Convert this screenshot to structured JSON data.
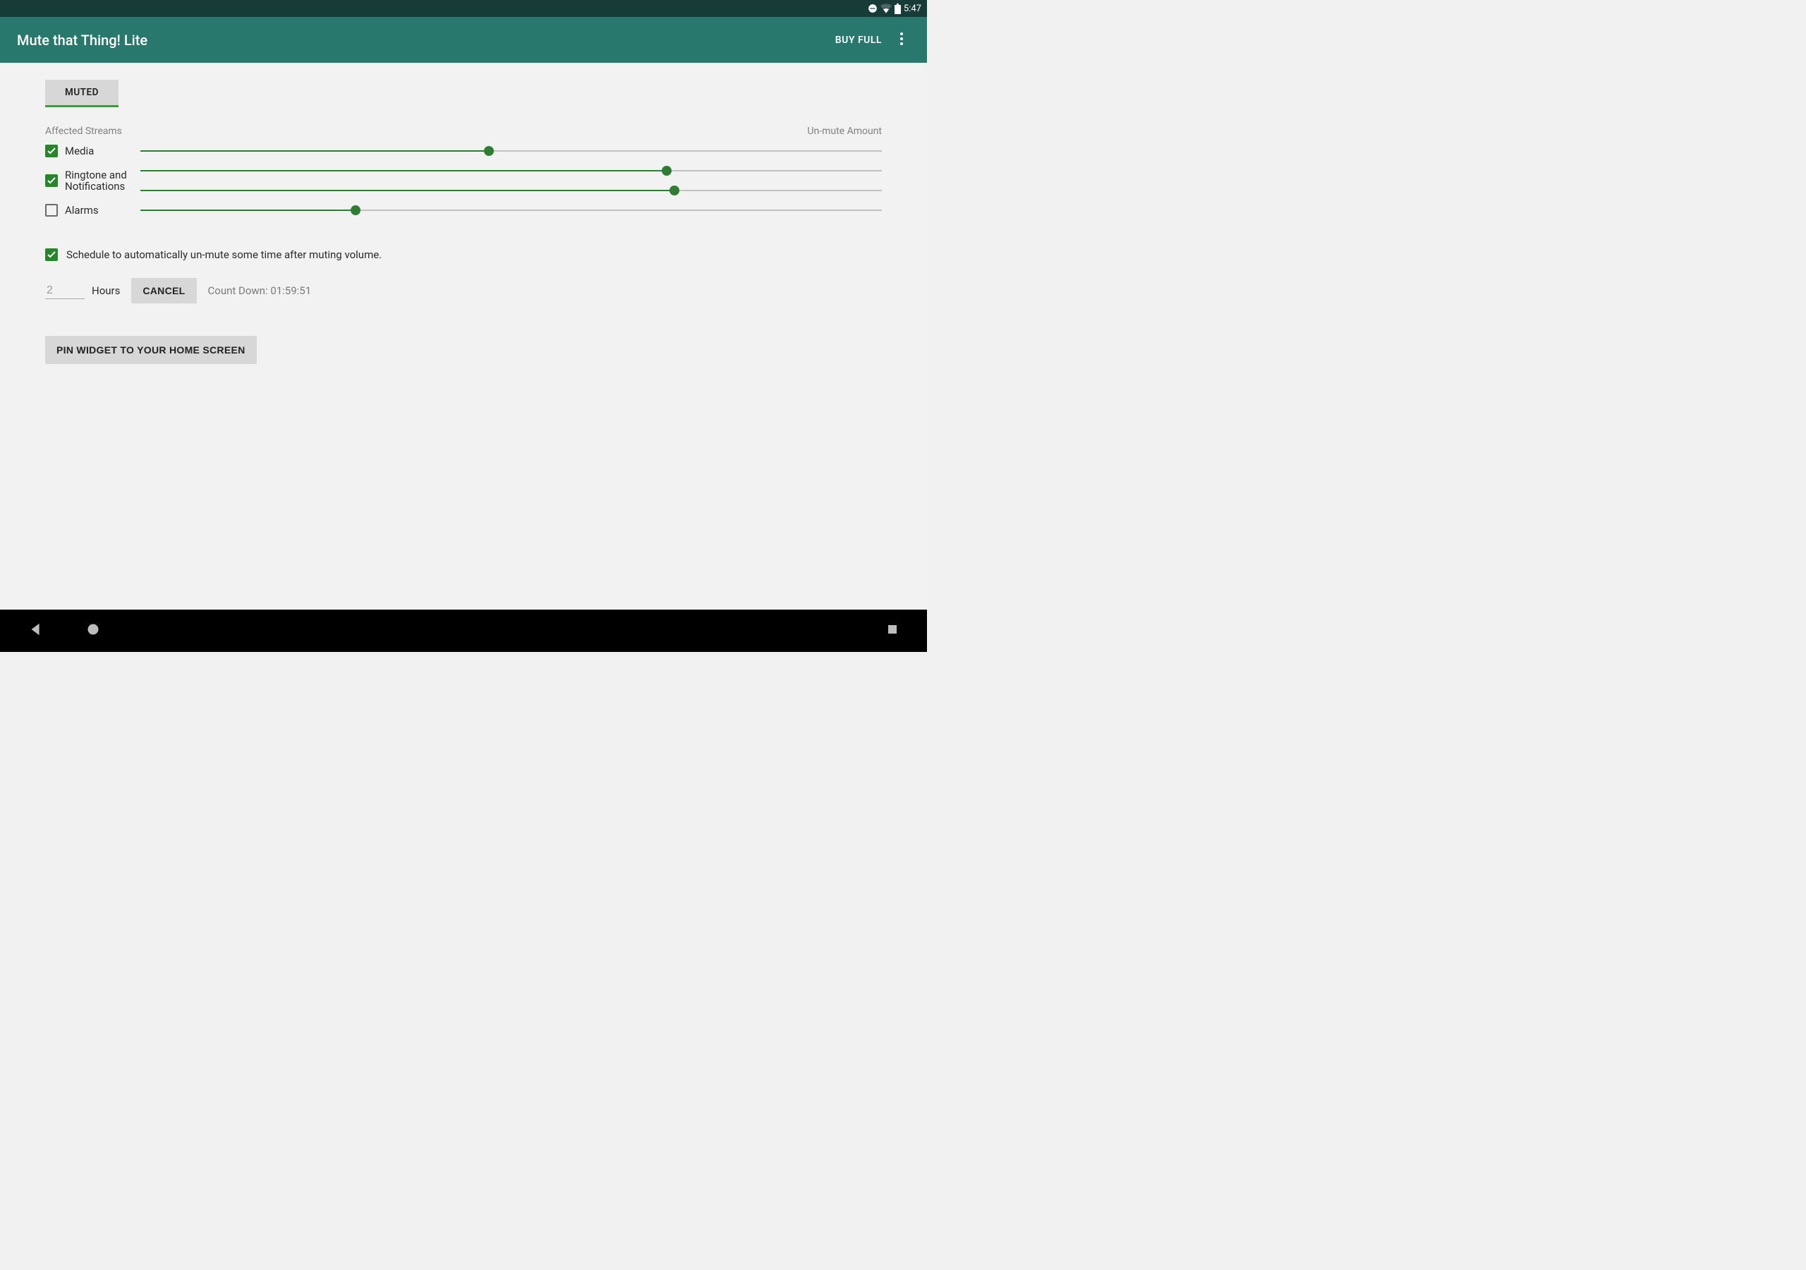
{
  "statusbar": {
    "time": "5:47"
  },
  "appbar": {
    "title": "Mute that Thing! Lite",
    "buy_full": "BUY FULL"
  },
  "tabs": {
    "muted": "MUTED"
  },
  "headers": {
    "affected_streams": "Affected Streams",
    "unmute_amount": "Un-mute Amount"
  },
  "streams": [
    {
      "label": "Media",
      "checked": true,
      "slider_percent": 47
    },
    {
      "label": "Ringtone and Notifications",
      "checked": true,
      "slider_percent_top": 71,
      "slider_percent_bottom": 72,
      "multiline": true
    },
    {
      "label": "Alarms",
      "checked": false,
      "slider_percent": 29
    }
  ],
  "schedule": {
    "checked": true,
    "text": "Schedule to automatically un-mute some time after muting volume.",
    "hours_value": "2",
    "hours_label": "Hours",
    "cancel": "CANCEL",
    "countdown_prefix": "Count Down: ",
    "countdown_value": "01:59:51"
  },
  "pin_button": "PIN WIDGET TO YOUR HOME SCREEN",
  "colors": {
    "accent": "#27852b",
    "primary": "#28786e",
    "primary_dark": "#173b37"
  }
}
